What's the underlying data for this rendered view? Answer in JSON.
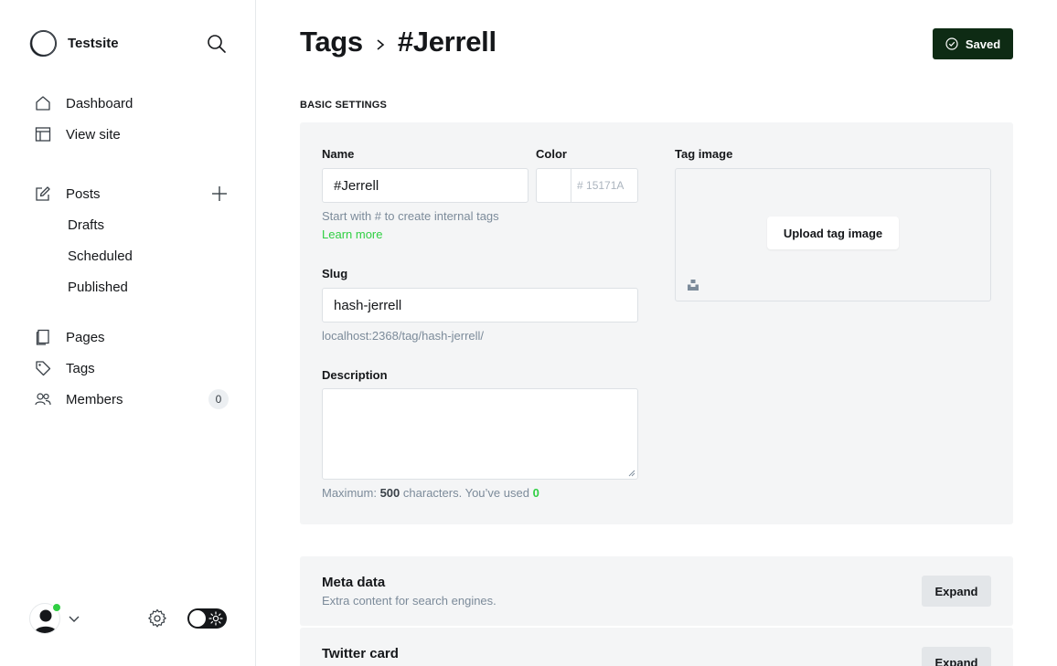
{
  "sidebar": {
    "site_name": "Testsite",
    "nav": {
      "dashboard": "Dashboard",
      "view_site": "View site",
      "posts": "Posts",
      "drafts": "Drafts",
      "scheduled": "Scheduled",
      "published": "Published",
      "pages": "Pages",
      "tags": "Tags",
      "members": "Members",
      "members_count": "0"
    },
    "icons": {
      "search": "search-icon",
      "plus": "plus-icon",
      "settings": "gear-icon",
      "theme_toggle": "sun-icon"
    },
    "status_color": "#30cf43"
  },
  "header": {
    "breadcrumb_parent": "Tags",
    "breadcrumb_current": "#Jerrell",
    "saved_label": "Saved",
    "saved_color": "#0e2b14"
  },
  "form": {
    "section_label": "BASIC SETTINGS",
    "name_label": "Name",
    "name_value": "#Jerrell",
    "name_hint": "Start with # to create internal tags",
    "learn_more": "Learn more",
    "color_label": "Color",
    "color_hash": "#",
    "color_value": "15171A",
    "slug_label": "Slug",
    "slug_value": "hash-jerrell",
    "slug_url": "localhost:2368/tag/hash-jerrell/",
    "description_label": "Description",
    "description_hint_prefix": "Maximum:",
    "description_max": "500",
    "description_hint_mid": "characters. You’ve used",
    "description_used": "0",
    "tag_image_label": "Tag image",
    "upload_label": "Upload tag image"
  },
  "cards": {
    "meta_title": "Meta data",
    "meta_sub": "Extra content for search engines.",
    "meta_expand": "Expand",
    "twitter_title": "Twitter card",
    "twitter_expand": "Expand"
  }
}
